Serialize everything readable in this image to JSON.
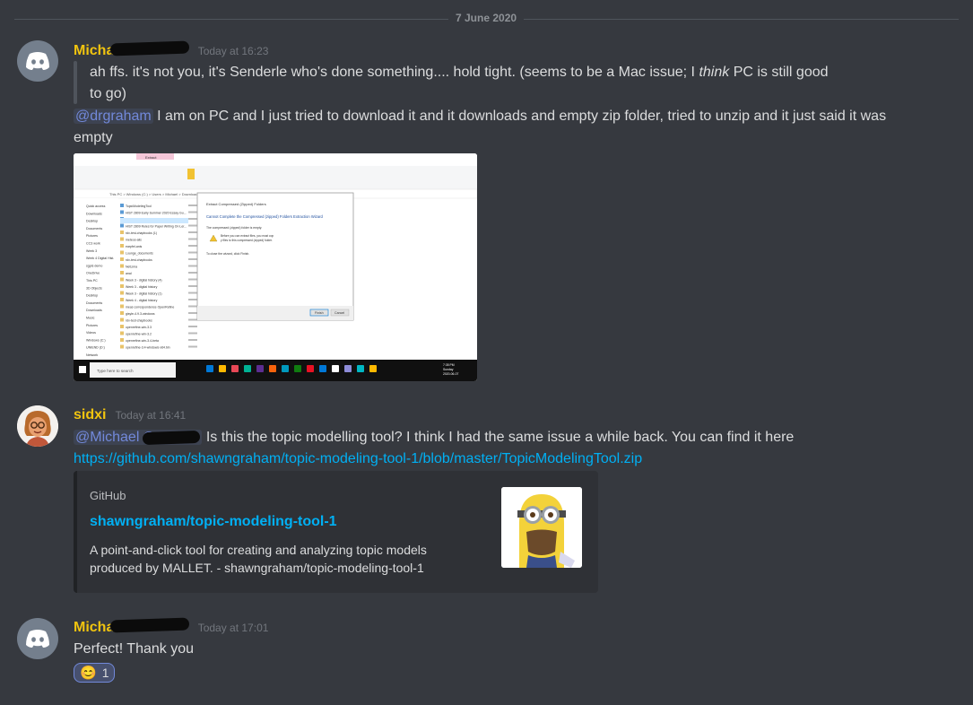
{
  "date_divider": "7 June 2020",
  "messages": [
    {
      "username": "Michael C",
      "timestamp": "Today at 16:23",
      "quote_text": "ah ffs. it's not you, it's Senderle who's done something.... hold tight. (seems to be a Mac issue; I ",
      "quote_emphasis": "think",
      "quote_tail": " PC is still good to go)",
      "mention": "@drgraham",
      "body": " I am on PC and I just tried to download it and it downloads and empty zip folder, tried to unzip and it just said it was empty",
      "attachment": {
        "explorer_title": "Extract",
        "wizard_header": "Extract Compressed (Zipped) Folders",
        "wizard_title": "Cannot Complete the Compressed (zipped) Folders Extraction Wizard",
        "wizard_line1": "The compressed (zipped) folder is empty.",
        "wizard_line2": "Before you can extract files, you must copy files to this compressed (zipped) folder.",
        "wizard_line3": "To close the wizard, click Finish.",
        "finish": "Finish",
        "cancel": "Cancel",
        "search_placeholder": "Type here to search",
        "tray_time": "7:35 PM",
        "tray_day": "Sunday",
        "tray_date": "2020-06-07",
        "address": "This PC > Windows (C:) > Users > Michael > Downloads",
        "nav_items": [
          "Quick access",
          "Downloads",
          "Desktop",
          "Documents",
          "Pictures",
          "CC3 work",
          "Week 3",
          "Week 4 Digital Hist.",
          "sgpls demo",
          "OneDrive",
          "This PC",
          "3D Objects",
          "Desktop",
          "Documents",
          "Downloads",
          "Music",
          "Pictures",
          "Videos",
          "Windows (C:)",
          "UNIEND (D:)",
          "Network"
        ],
        "file_rows": [
          "TopicModelingTool",
          "HIST 2809 Early Summer 2020 Essay Gu...",
          "HIST 2809 Early Summer 2020 Outside A...",
          "HIST 2809 Rules for Paper Writing On Ler...",
          "rdv-test-chapbooks (1)",
          "meteos-alis",
          "earpfel-anis",
          "Lounge_documents",
          "rdv-test-chapbooks",
          "NetLima",
          "anal",
          "Week 3 - digital history (4)",
          "Week 3 - digital history",
          "Week 3 - digital history (1)",
          "Week 4 - digital history",
          "meas correspondence OpenRefine",
          "gisyle-4.9.3-windows",
          "rdv-test-chapbooks",
          "openrefine-win-3.3",
          "openrefine-win-3.2",
          "openrefine-win-3.4-beta",
          "openrefine-3.4-windows-x64.bin"
        ]
      }
    },
    {
      "username": "sidxi",
      "timestamp": "Today at 16:41",
      "mention": "@Michael C",
      "body": " Is this the topic modelling tool? I think I had the same issue a while back. You can find it here",
      "link": "https://github.com/shawngraham/topic-modeling-tool-1/blob/master/TopicModelingTool.zip",
      "embed": {
        "provider": "GitHub",
        "title": "shawngraham/topic-modeling-tool-1",
        "description": "A point-and-click tool for creating and analyzing topic models produced by MALLET. - shawngraham/topic-modeling-tool-1"
      }
    },
    {
      "username": "Michael C",
      "timestamp": "Today at 17:01",
      "body": "Perfect! Thank you",
      "reaction": {
        "emoji": "😊",
        "count": "1"
      }
    }
  ],
  "colors": {
    "background": "#36393f",
    "username": "#f1c40f",
    "link": "#00b0f4",
    "mention": "#7289da",
    "embed_bg": "#2f3136"
  }
}
